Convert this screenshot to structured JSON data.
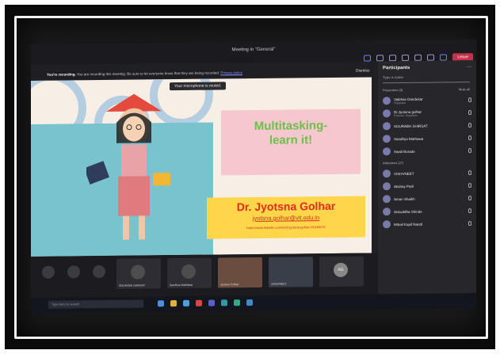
{
  "window": {
    "title": "Meeting in \"General\"",
    "leave_label": "Leave"
  },
  "recording_banner": {
    "title": "You're recording.",
    "message": "You are recording this meeting. Be sure to let everyone know that they are being recorded.",
    "link": "Privacy policy",
    "dismiss_label": "Dismiss"
  },
  "toast": "Your microphone is muted.",
  "slide": {
    "title_line1": "Multitasking-",
    "title_line2": "learn it!",
    "name": "Dr. Jyotsna Golhar",
    "email": "jyotsna.golhar@vit.edu.in",
    "link": "https://www.linkedin.com/in/dr-jyotsna-golhar-00306b79/"
  },
  "participants": {
    "title": "Participants",
    "search_placeholder": "Type a name",
    "presenters_label": "Presenters (3)",
    "mute_all_label": "Mute all",
    "attendees_label": "Attendees (27)",
    "presenters": [
      {
        "name": "Vaibhav Dandekar",
        "role": "Organizer"
      },
      {
        "name": "Dr.Jyotsna golhar",
        "role": "External, Organizer"
      },
      {
        "name": "SOURABH SHIRSAT",
        "role": ""
      },
      {
        "name": "Sandhya Mathawa",
        "role": ""
      },
      {
        "name": "Swati Borade",
        "role": ""
      }
    ],
    "attendees": [
      {
        "name": "VISHVNEET",
        "role": ""
      },
      {
        "name": "Akshay Patil",
        "role": ""
      },
      {
        "name": "Aman Shaikh",
        "role": ""
      },
      {
        "name": "Aniruddha Shinde",
        "role": ""
      },
      {
        "name": "Mihail Kapil Nandi",
        "role": ""
      }
    ]
  },
  "video_tiles": [
    {
      "label": "SOURABH SHIRSAT"
    },
    {
      "label": "Sandhya Mathawa"
    },
    {
      "label": "Jyotsna Golhar"
    },
    {
      "label": "VISHVNEET"
    },
    {
      "label": "AG"
    }
  ],
  "taskbar": {
    "search_placeholder": "Type here to search"
  },
  "colors": {
    "teams_accent": "#6f7bf7",
    "leave_red": "#c4314b",
    "slide_green": "#6cc04a",
    "slide_red": "#e02b20",
    "slide_yellow": "#ffd54a",
    "slide_pink": "#f6c7cf"
  }
}
